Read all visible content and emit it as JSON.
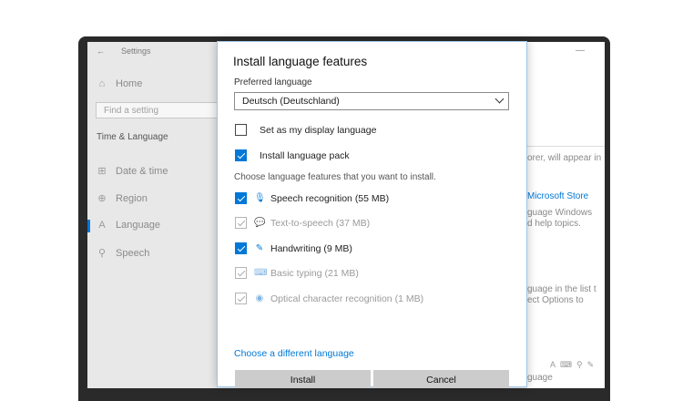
{
  "settings": {
    "window_title": "Settings",
    "back_glyph": "←",
    "nav": {
      "home": "Home",
      "search_placeholder": "Find a setting",
      "section": "Time & Language",
      "items": [
        {
          "icon": "calendar-icon",
          "glyph": "⊞",
          "label": "Date & time"
        },
        {
          "icon": "globe-icon",
          "glyph": "⊕",
          "label": "Region"
        },
        {
          "icon": "language-icon",
          "glyph": "A",
          "label": "Language"
        },
        {
          "icon": "microphone-icon",
          "glyph": "⚲",
          "label": "Speech"
        }
      ]
    },
    "minimize_glyph": "—",
    "right_fragments": {
      "line1": "orer, will appear in",
      "store_link": "Microsoft Store",
      "line2": "guage Windows",
      "line3": "d help topics.",
      "line4": "guage in the list t",
      "line5": "ect Options to",
      "line6": "guage"
    }
  },
  "dialog": {
    "title": "Install language features",
    "preferred_label": "Preferred language",
    "selected_language": "Deutsch (Deutschland)",
    "display_language_option": {
      "label": "Set as my display language",
      "checked": false
    },
    "language_pack_option": {
      "label": "Install language pack",
      "checked": true
    },
    "choose_label": "Choose language features that you want to install.",
    "features": [
      {
        "icon": "microphone-icon",
        "glyph": "🎙",
        "label": "Speech recognition (55 MB)",
        "checked": true,
        "enabled": true
      },
      {
        "icon": "speech-bubble-icon",
        "glyph": "💬",
        "label": "Text-to-speech (37 MB)",
        "checked": true,
        "enabled": false
      },
      {
        "icon": "handwriting-icon",
        "glyph": "✎",
        "label": "Handwriting (9 MB)",
        "checked": true,
        "enabled": true
      },
      {
        "icon": "keyboard-icon",
        "glyph": "⌨",
        "label": "Basic typing (21 MB)",
        "checked": true,
        "enabled": false
      },
      {
        "icon": "ocr-icon",
        "glyph": "◉",
        "label": "Optical character recognition (1 MB)",
        "checked": true,
        "enabled": false
      }
    ],
    "different_language_link": "Choose a different language",
    "install_button": "Install",
    "cancel_button": "Cancel"
  },
  "colors": {
    "accent": "#0078d7",
    "dialog_border": "#9ec3e6"
  }
}
